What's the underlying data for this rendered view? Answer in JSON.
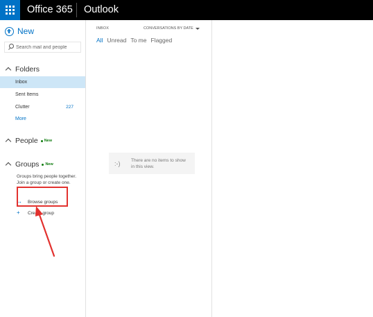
{
  "topbar": {
    "suite_title": "Office 365",
    "app_title": "Outlook"
  },
  "nav": {
    "new_label": "New",
    "search_placeholder": "Search mail and people",
    "folders_label": "Folders",
    "folders": [
      {
        "name": "Inbox",
        "count": "",
        "selected": true
      },
      {
        "name": "Sent Items",
        "count": ""
      },
      {
        "name": "Clutter",
        "count": "227"
      },
      {
        "name": "More",
        "count": ""
      }
    ],
    "people_label": "People",
    "groups_label": "Groups",
    "new_badge": "New",
    "groups_description": "Groups bring people together. Join a group or create one.",
    "browse_groups": "Browse groups",
    "create_group": "Create group"
  },
  "list": {
    "header": "INBOX",
    "sort_label": "CONVERSATIONS BY DATE",
    "filters": [
      "All",
      "Unread",
      "To me",
      "Flagged"
    ],
    "active_filter": "All",
    "empty_face": ":-)",
    "empty_message": "There are no items to show in this view."
  },
  "colors": {
    "brand_blue": "#0072c6",
    "topbar": "#000000",
    "selected_bg": "#cde6f7",
    "new_badge_green": "#107c10",
    "highlight_red": "#e2312e"
  }
}
